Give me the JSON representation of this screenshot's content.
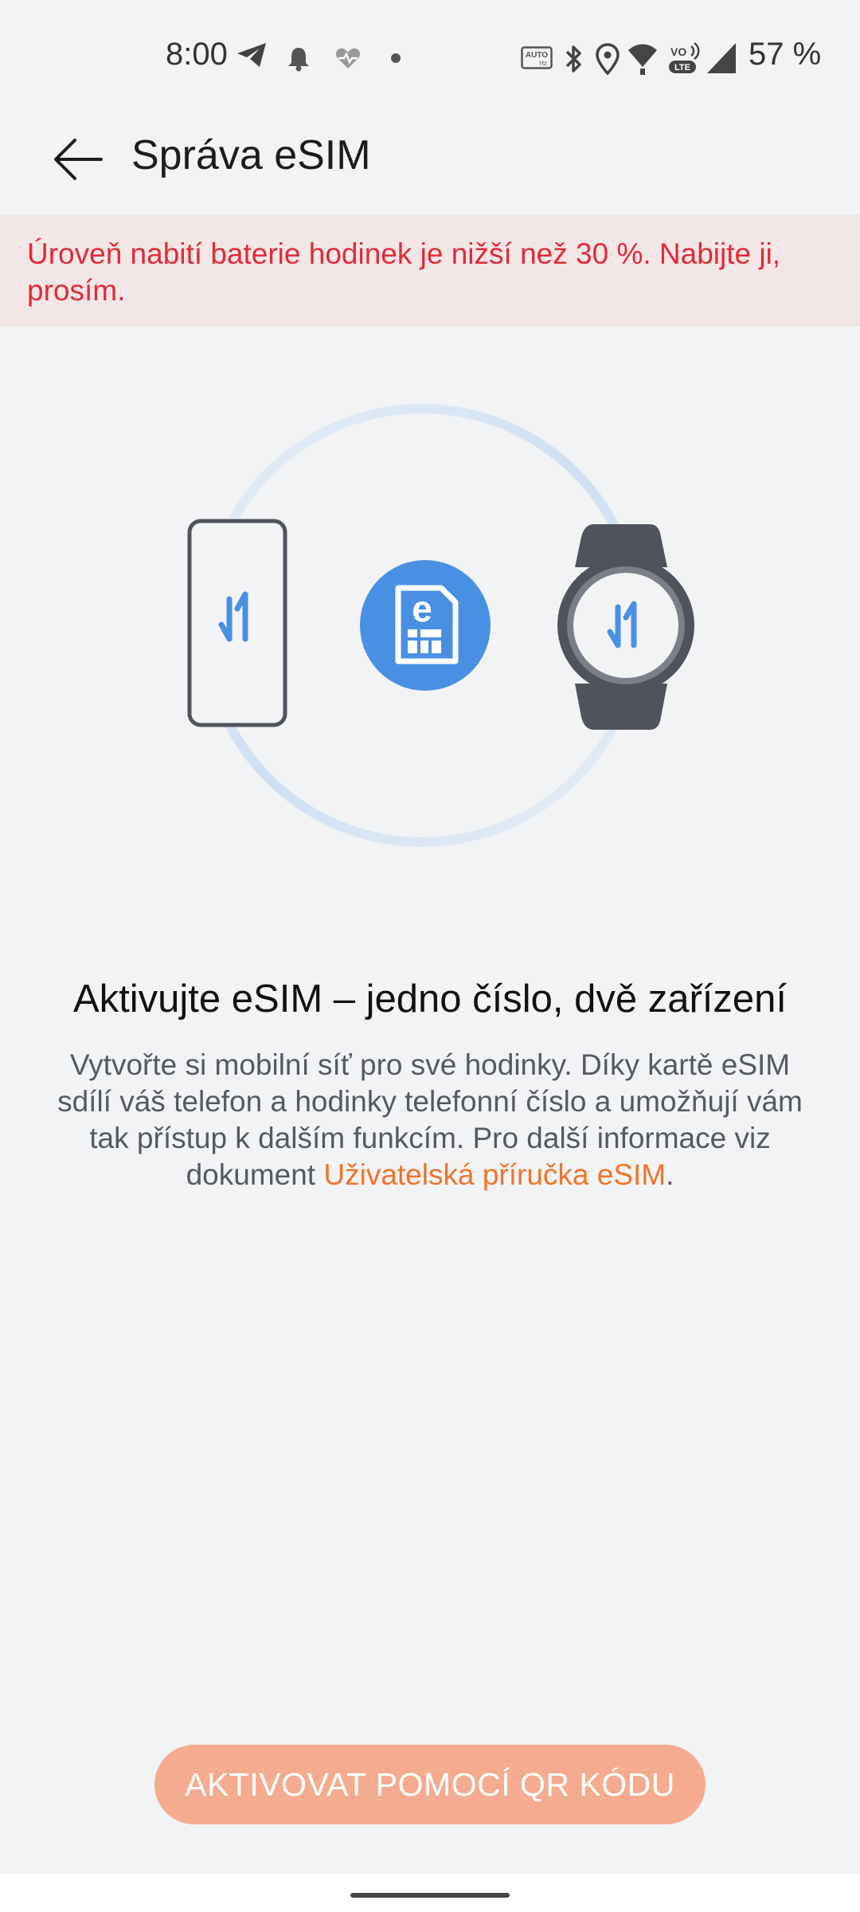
{
  "status_bar": {
    "time": "8:00",
    "battery": "57 %",
    "icons": [
      "telegram-icon",
      "bell-icon",
      "heart-rate-icon",
      "dot-icon",
      "auto-hz-icon",
      "bluetooth-icon",
      "location-icon",
      "wifi-icon",
      "volte-icon",
      "signal-icon"
    ]
  },
  "app_bar": {
    "title": "Správa eSIM",
    "back_icon": "arrow-left-icon"
  },
  "warning": {
    "text": "Úroveň nabití baterie hodinek je nižší než 30 %. Nabijte ji, prosím.",
    "color": "#e02b37",
    "background": "#f3e6e7"
  },
  "illustration": {
    "icons": [
      "phone-icon",
      "esim-icon",
      "watch-icon",
      "transfer-icon"
    ],
    "accent": "#4a90e2"
  },
  "content": {
    "headline": "Aktivujte eSIM – jedno číslo, dvě zařízení",
    "description_before_link": "Vytvořte si mobilní síť pro své hodinky. Díky kartě eSIM sdílí váš telefon a hodinky telefonní číslo a umožňují vám tak přístup k dalším funkcím. Pro další informace viz dokument ",
    "link_text": "Uživatelská příručka eSIM",
    "description_after_link": ".",
    "link_color": "#f0742a"
  },
  "action": {
    "button_label": "AKTIVOVAT POMOCÍ QR KÓDU",
    "button_color": "#f5ab8f"
  }
}
